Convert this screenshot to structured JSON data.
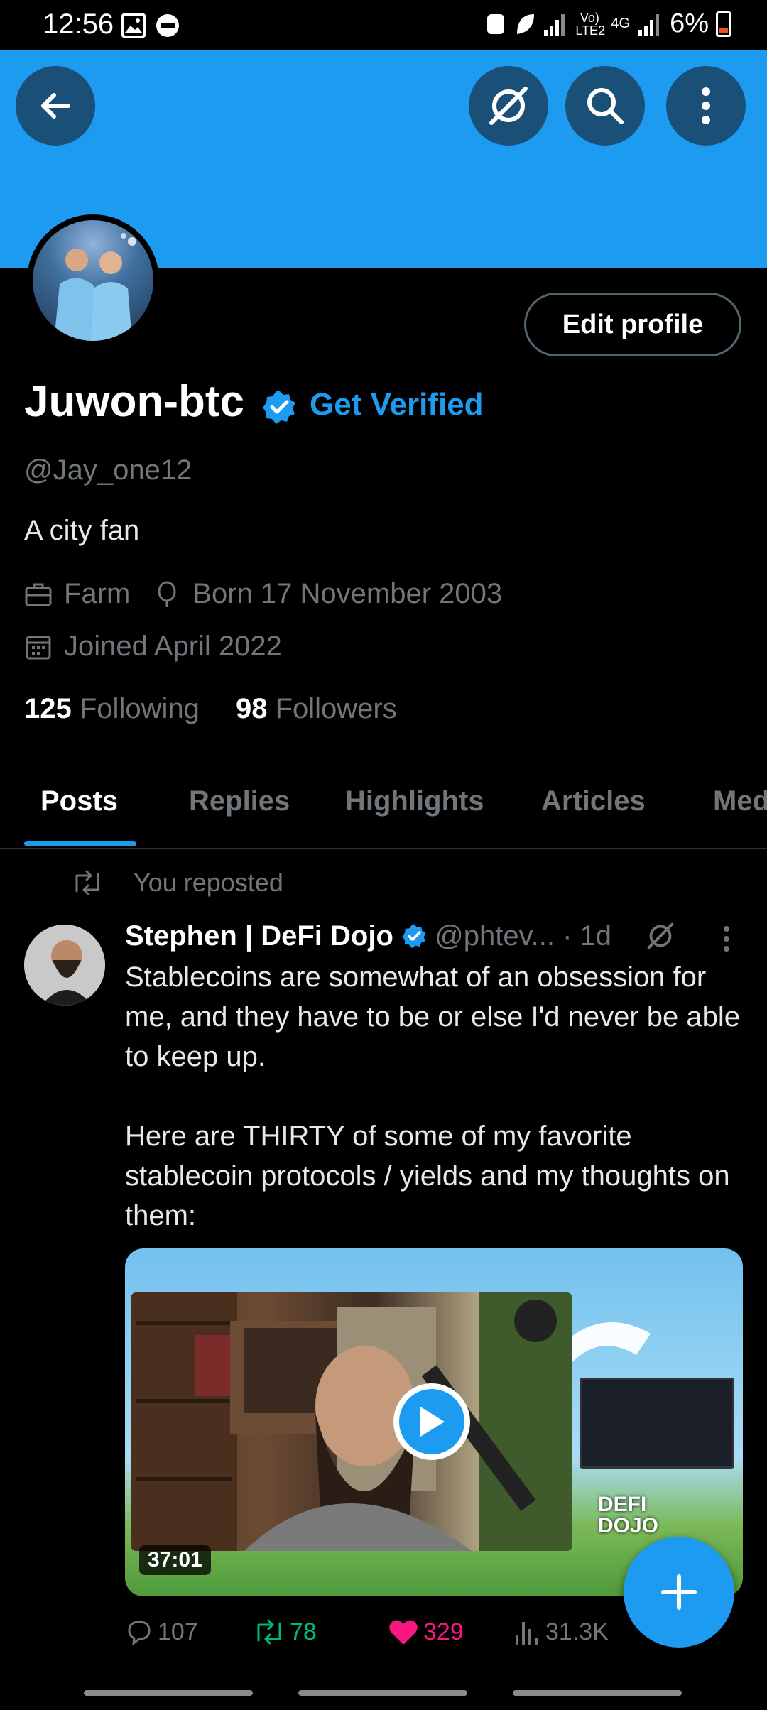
{
  "status_bar": {
    "time": "12:56",
    "battery": "6%",
    "network": "4G",
    "volte": "Vo) LTE2"
  },
  "banner": {
    "color": "#1d9bf0"
  },
  "profile": {
    "name": "Juwon-btc",
    "get_verified": "Get Verified",
    "handle": "@Jay_one12",
    "bio": "A city fan",
    "job": "Farm",
    "birth": "Born 17 November 2003",
    "joined": "Joined April 2022",
    "following_count": "125",
    "following_label": "Following",
    "followers_count": "98",
    "followers_label": "Followers",
    "edit_label": "Edit profile"
  },
  "tabs": [
    "Posts",
    "Replies",
    "Highlights",
    "Articles",
    "Media"
  ],
  "post": {
    "repost_label": "You reposted",
    "author_name": "Stephen | DeFi Dojo",
    "author_handle": "@phtev...",
    "time": "· 1d",
    "text": "Stablecoins are somewhat of an obsession for me, and they have to be or else I'd never be able to keep up.\n\nHere are THIRTY of some of my favorite stablecoin protocols / yields and my thoughts on them:",
    "video_duration": "37:01",
    "logo_text": "DEFI DOJO",
    "replies": "107",
    "reposts": "78",
    "likes": "329",
    "views": "31.3K"
  },
  "colors": {
    "accent": "#1d9bf0",
    "repost_green": "#00ba7c",
    "like_pink": "#f91880",
    "muted": "#71767b"
  }
}
